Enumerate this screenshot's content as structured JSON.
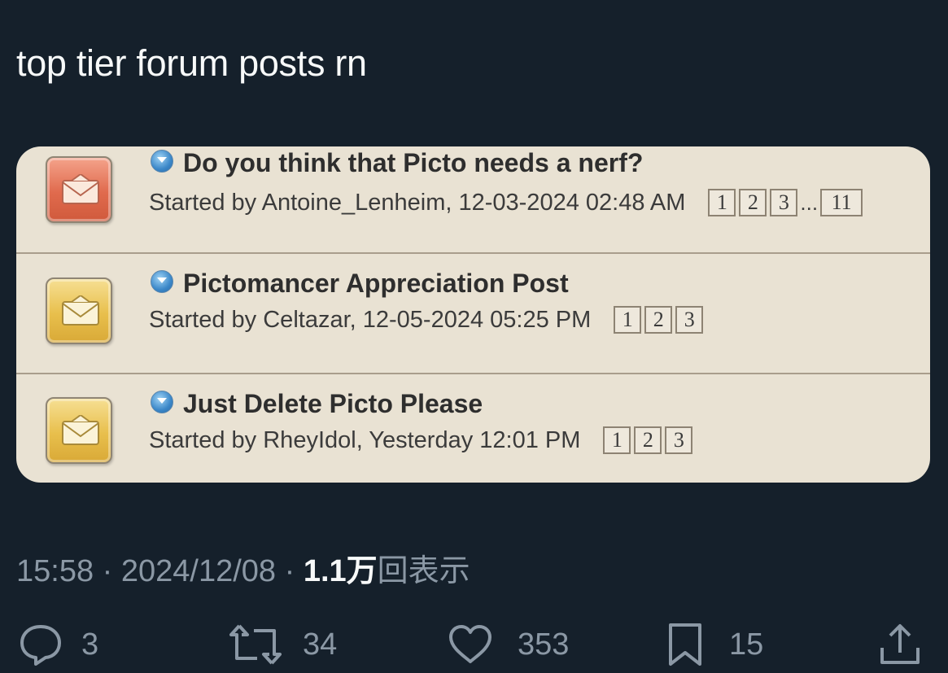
{
  "tweet": {
    "text": "top tier forum posts rn"
  },
  "forum": {
    "topics": [
      {
        "title": "Do you think that Picto needs a nerf?",
        "meta": "Started by Antoine_Lenheim, 12-03-2024 02:48 AM",
        "status": "hot",
        "pages": [
          "1",
          "2",
          "3"
        ],
        "ellipsis": "...",
        "last_page": "11"
      },
      {
        "title": "Pictomancer Appreciation Post",
        "meta": "Started by Celtazar, 12-05-2024 05:25 PM",
        "status": "normal",
        "pages": [
          "1",
          "2",
          "3"
        ]
      },
      {
        "title": "Just Delete Picto Please",
        "meta": "Started by RheyIdol, Yesterday 12:01 PM",
        "status": "normal",
        "pages": [
          "1",
          "2",
          "3"
        ]
      }
    ],
    "colors": {
      "background": "#e9e2d3",
      "hot_icon": "#e06a4d",
      "normal_icon": "#e8bf4c",
      "new_post_icon": "#3b87c8"
    }
  },
  "tweet_meta": {
    "time": "15:58",
    "date": "2024/12/08",
    "separator": "·",
    "views_count": "1.1万",
    "views_label": "回表示"
  },
  "actions": {
    "replies": "3",
    "reposts": "34",
    "likes": "353",
    "bookmarks": "15"
  },
  "icons": [
    "reply-icon",
    "repost-icon",
    "like-icon",
    "bookmark-icon",
    "share-icon",
    "envelope-icon",
    "new-post-arrow-icon"
  ],
  "colors": {
    "background": "#15202b",
    "text_primary": "#f7f9f9",
    "text_secondary": "#8b98a5"
  }
}
